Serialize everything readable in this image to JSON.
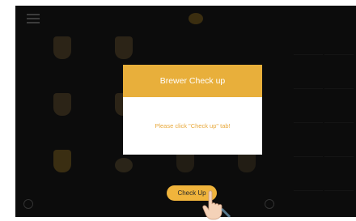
{
  "modal": {
    "title": "Brewer Check up",
    "message": "Please click \"Check up\" tab!"
  },
  "button": {
    "checkup_label": "Check Up"
  },
  "icons": {
    "menu": "menu-icon",
    "logo": "logo-icon",
    "hand": "pointing-hand-icon",
    "power": "power-icon",
    "settings": "settings-icon"
  },
  "colors": {
    "accent": "#e8af3b",
    "background": "#0c0c0c",
    "modal_background": "#ffffff",
    "message_text": "#e8a93c"
  }
}
